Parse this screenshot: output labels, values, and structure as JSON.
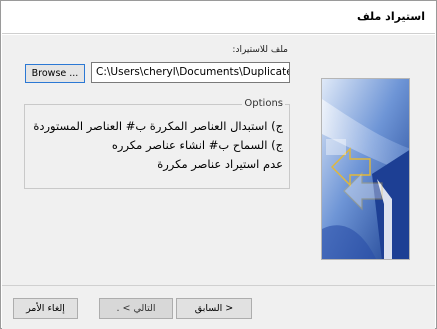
{
  "header": {
    "title": "استيراد ملف"
  },
  "form": {
    "file_label": "ملف للاستيراد:",
    "file_path": "C:\\Users\\cheryl\\Documents\\Duplicates.CS",
    "browse_label": "Browse ..."
  },
  "options": {
    "legend": "Options",
    "items": [
      {
        "label": "ج) استبدال العناصر المكررة ب# العناصر المستوردة",
        "selected": false
      },
      {
        "label": "ج) السماح ب# انشاء عناصر مكرره",
        "selected": false
      },
      {
        "label": "عدم استيراد عناصر مكررة",
        "selected": false
      }
    ]
  },
  "footer": {
    "cancel_label": "إلغاء الأمر",
    "next_label": "التالي > .",
    "back_label": "< السابق"
  },
  "colors": {
    "accent": "#2b78d4",
    "art_dark": "#1f3f8f",
    "art_light": "#a9c4ec",
    "art_gold": "#e2b838"
  }
}
